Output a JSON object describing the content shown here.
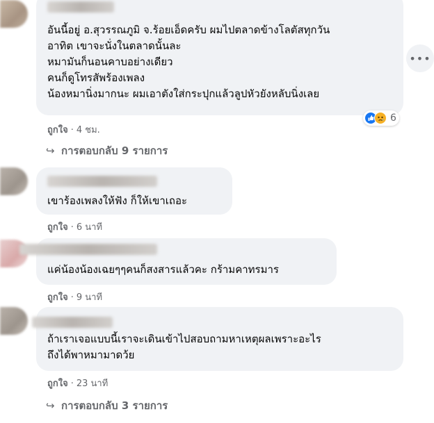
{
  "comments": [
    {
      "text": "อันนี้อยู่ อ.สุวรรณภูมิ จ.ร้อยเอ็ดครับ ผมไปตลาดข้างโลตัสทุกวัน\nอาทิต เขาจะนั่งในตลาดนั้นละ\nหมามันก็นอนคาบอย่างเดียว\nคนก็ดูโทรสัพร้องเพลง\nน้องหมานิ่งมากนะ ผมเอาตังใส่กระปุกแล้วลูปหัวยังหลับนิ่งเลย",
      "like_label": "ถูกใจ",
      "time": "4 ชม.",
      "reaction_count": "6",
      "replies_label": "การตอบกลับ 9 รายการ"
    },
    {
      "text": "เขาร้องเพลงให้ฟัง ก็ให้เขาเถอะ",
      "like_label": "ถูกใจ",
      "time": "6 นาที"
    },
    {
      "text": "แค่น้องน้องเฉยๆๆคนก็สงสารแล้วคะ กร้ามคาทรมาร",
      "like_label": "ถูกใจ",
      "time": "9 นาที"
    },
    {
      "text": "ถ้าเราเจอแบบนี้เราจะเดินเข้าไปสอบถามหาเหตุผลเพราะอะไร\nถึงได้พาหมามาดว้ย",
      "like_label": "ถูกใจ",
      "time": "23 นาที",
      "replies_label": "การตอบกลับ 3 รายการ"
    }
  ],
  "more_label": "•••",
  "reaction_icons": [
    "like-icon",
    "sad-icon"
  ],
  "colors": {
    "bubble": "#f0f2f5",
    "meta": "#65676b",
    "like_blue": "#1877f2",
    "sad_yellow": "#f7b125"
  }
}
